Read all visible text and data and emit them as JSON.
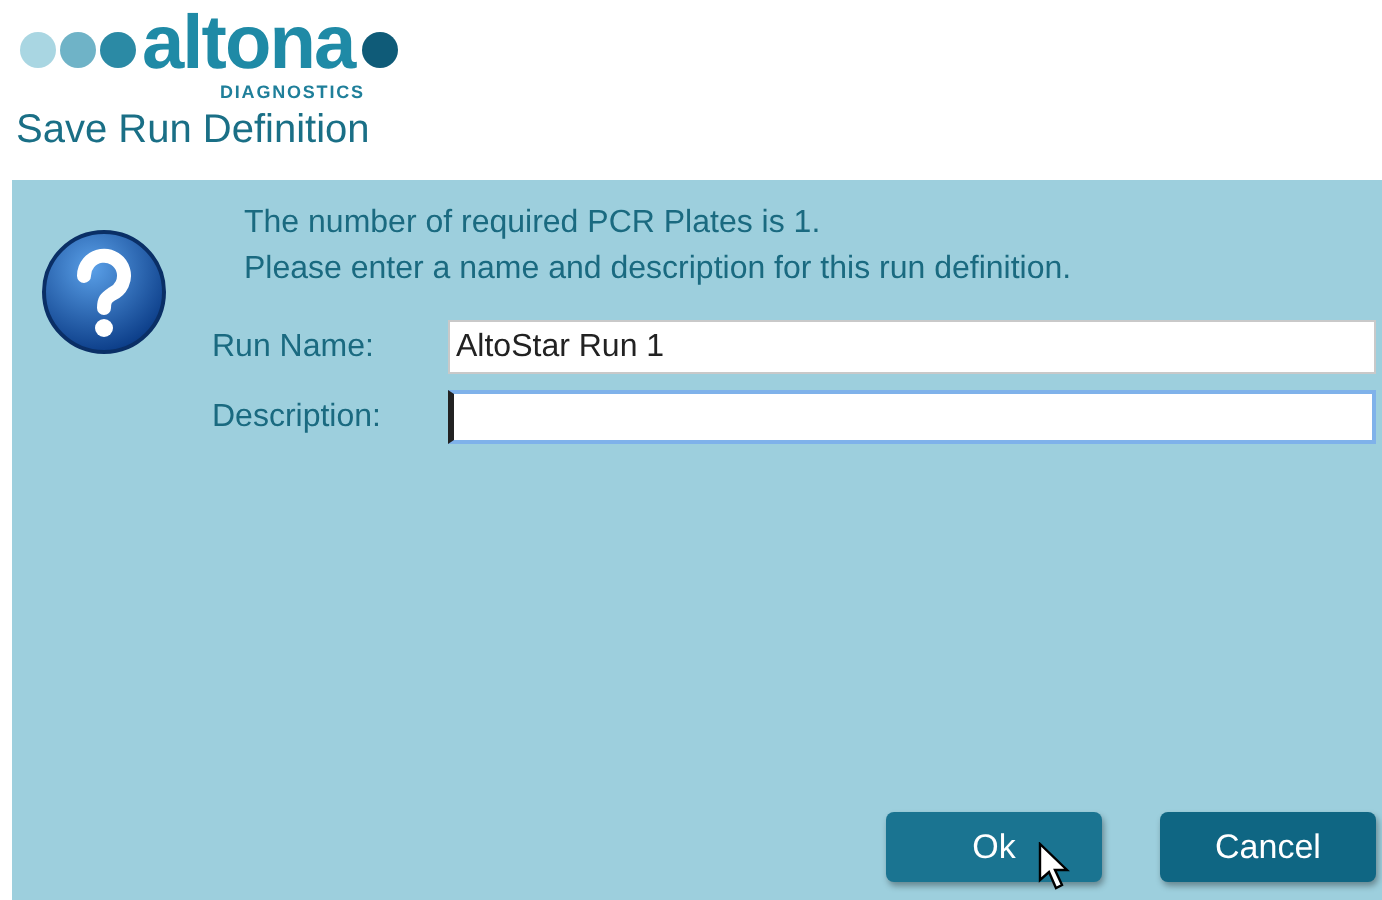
{
  "logo": {
    "wordmark": "altona",
    "subtitle": "DIAGNOSTICS"
  },
  "window": {
    "title": "Save Run Definition"
  },
  "message": [
    "The number of required PCR Plates is 1.",
    "Please enter a name and description for this run definition."
  ],
  "fields": [
    {
      "label": "Run Name:",
      "value": "AltoStar Run 1",
      "focused": false
    },
    {
      "label": "Description:",
      "focused": true
    }
  ],
  "buttons": [
    {
      "label": "Ok",
      "hovered": true
    },
    {
      "label": "Cancel",
      "hovered": false
    }
  ]
}
